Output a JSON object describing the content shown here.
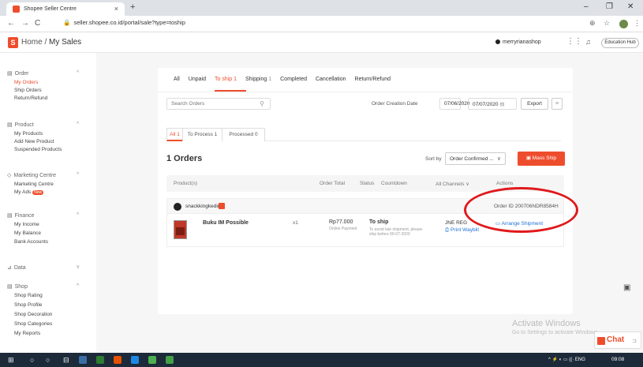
{
  "browser": {
    "tab_title": "Shopee Seller Centre",
    "tab_close": "×",
    "new_tab": "+",
    "url": "seller.shopee.co.id/portal/sale?type=toship",
    "win_min": "–",
    "win_max": "❐",
    "win_close": "✕"
  },
  "header": {
    "home": "Home",
    "sep": " / ",
    "page": "My Sales",
    "shop_name": "merryrianashop",
    "education_hub": "Education Hub"
  },
  "sidebar": {
    "sections": [
      {
        "title": "Order",
        "items": [
          "My Orders",
          "Ship Orders",
          "Return/Refund"
        ]
      },
      {
        "title": "Product",
        "items": [
          "My Products",
          "Add New Product",
          "Suspended Products"
        ]
      },
      {
        "title": "Marketing Centre",
        "items": [
          "Marketing Centre",
          "My Ads"
        ]
      },
      {
        "title": "Finance",
        "items": [
          "My Income",
          "My Balance",
          "Bank Accounts"
        ]
      },
      {
        "title": "Data",
        "items": []
      },
      {
        "title": "Shop",
        "items": [
          "Shop Rating",
          "Shop Profile",
          "Shop Decoration",
          "Shop Categories",
          "My Reports"
        ]
      }
    ],
    "new_badge": "New"
  },
  "status_tabs": [
    {
      "label": "All",
      "count": ""
    },
    {
      "label": "Unpaid",
      "count": ""
    },
    {
      "label": "To ship",
      "count": "1"
    },
    {
      "label": "Shipping",
      "count": "1"
    },
    {
      "label": "Completed",
      "count": ""
    },
    {
      "label": "Cancellation",
      "count": ""
    },
    {
      "label": "Return/Refund",
      "count": ""
    }
  ],
  "filters": {
    "search_placeholder": "Search Orders",
    "date_label": "Order Creation Date",
    "date_from": "07/06/2020",
    "date_sep": "-",
    "date_to": "07/07/2020",
    "export": "Export"
  },
  "sub_tabs": [
    "All 1",
    "To Process 1",
    "Processed 0"
  ],
  "orders": {
    "title": "1 Orders",
    "sort_label": "Sort by",
    "sort_value": "Order Confirmed ...",
    "mass_ship": "Mass Ship"
  },
  "table": {
    "columns": [
      "Product(s)",
      "Order Total",
      "Status",
      "Countdown",
      "All Channels",
      "Actions"
    ]
  },
  "order": {
    "shop": "snackkingkediri",
    "order_id": "Order ID 200706NDR8584H",
    "product": "Buku IM Possible",
    "qty": "x1",
    "total": "Rp77.000",
    "payment": "Online Payment",
    "status": "To ship",
    "status_desc": "To avoid late shipment, please ship before 09-07-2020",
    "carrier": "JNE REG",
    "print_waybill": "Print Waybill",
    "arrange_shipment": "Arrange Shipment"
  },
  "watermark": {
    "line1": "Activate Windows",
    "line2": "Go to Settings to activate Windows."
  },
  "chat": {
    "label": "Chat"
  },
  "taskbar": {
    "tray": "ENG",
    "time": "09:08"
  },
  "colors": {
    "accent": "#ee4d2d",
    "link": "#1e70d6",
    "highlight": "#e0191c"
  }
}
